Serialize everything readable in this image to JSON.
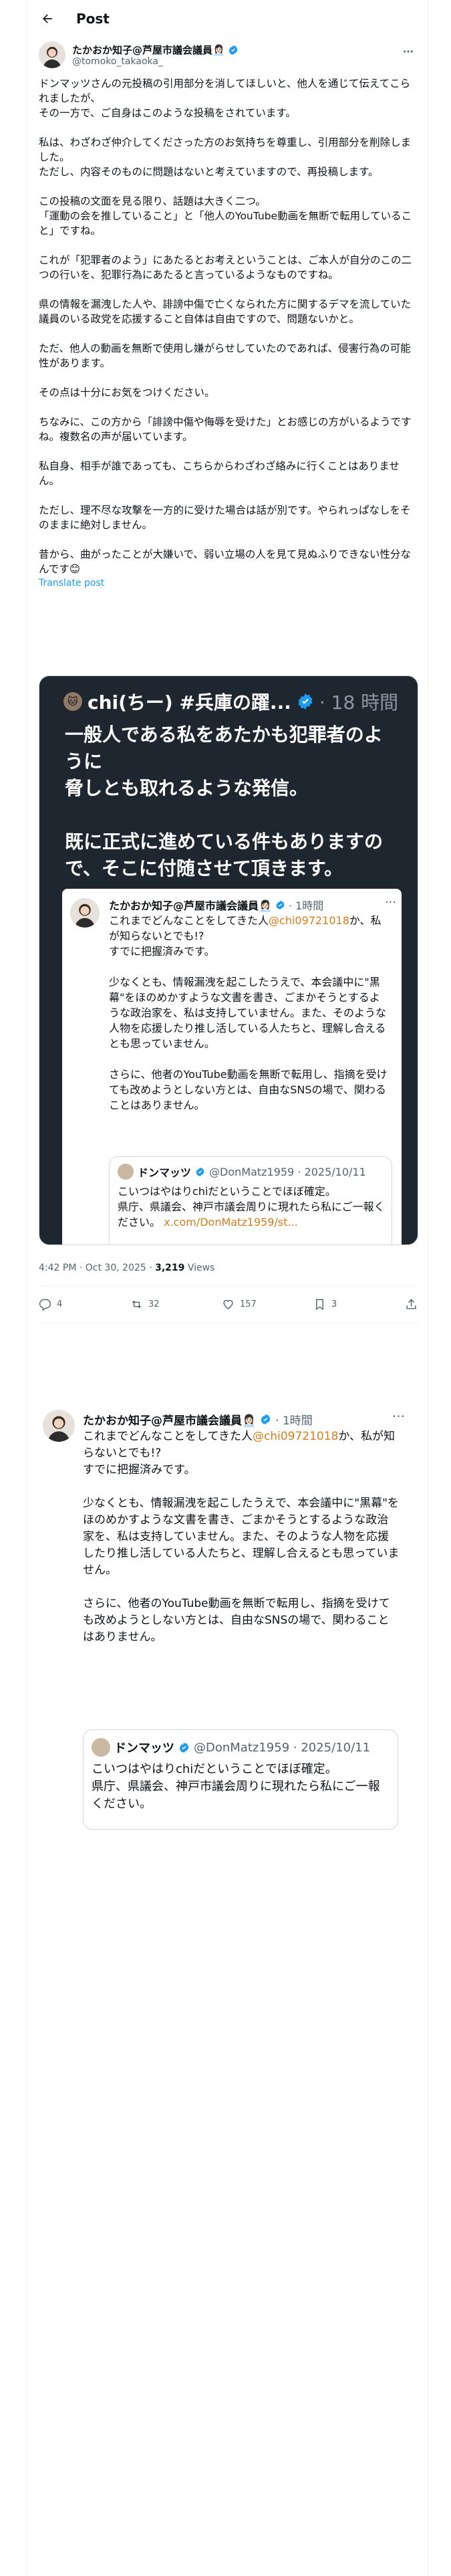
{
  "colors": {
    "accent": "#1d9bf0",
    "mention": "#d67c1b",
    "muted": "#536471",
    "card_dark": "#1e272f"
  },
  "topbar": {
    "title": "Post",
    "back_icon": "arrow-left-icon"
  },
  "author": {
    "name": "たかおか知子@芦屋市議会議員👩🏻‍💼",
    "handle": "@tomoko_takaoka_",
    "verified_icon": "verified-badge-icon",
    "more_icon": "more-icon"
  },
  "post": {
    "paragraphs": [
      "ドンマッツさんの元投稿の引用部分を消してほしいと、他人を通じて伝えてこられましたが、\nその一方で、ご自身はこのような投稿をされています。",
      "私は、わざわざ仲介してくださった方のお気持ちを尊重し、引用部分を削除しました。\nただし、内容そのものに問題はないと考えていますので、再投稿します。",
      "この投稿の文面を見る限り、話題は大きく二つ。\n「運動の会を推していること」と「他人のYouTube動画を無断で転用していること」ですね。",
      "これが「犯罪者のよう」にあたるとお考えということは、ご本人が自分のこの二つの行いを、犯罪行為にあたると言っているようなものですね。",
      "県の情報を漏洩した人や、誹謗中傷で亡くなられた方に関するデマを流していた議員のいる政党を応援すること自体は自由ですので、問題ないかと。",
      "ただ、他人の動画を無断で使用し嫌がらせしていたのであれば、侵害行為の可能性があります。",
      "その点は十分にお気をつけください。",
      "ちなみに、この方から「誹謗中傷や侮辱を受けた」とお感じの方がいるようですね。複数名の声が届いています。",
      "私自身、相手が誰であっても、こちらからわざわざ絡みに行くことはありません。",
      "ただし、理不尽な攻撃を一方的に受けた場合は話が別です。やられっぱなしをそのままに絶対しません。",
      "昔から、曲がったことが大嫌いで、弱い立場の人を見て見ぬふりできない性分なんです😊"
    ],
    "translate_label": "Translate post"
  },
  "media": {
    "avatar_emoji": "🐱",
    "name": "chi(ちー) #兵庫の躍...",
    "time": "· 18 時間",
    "text": "一般人である私をあたかも犯罪者のように\n脅しとも取れるような発信。\n\n既に正式に進めている件もありますので、そこに付随させて頂きます。",
    "inner": {
      "name": "たかおか知子@芦屋市議会議員👩🏻‍💼",
      "time": "· 1時間",
      "text_before_mention": "これまでどんなことをしてきた人",
      "mention": "@chi09721018",
      "text_after_mention": "か、私が知らないとでも!?\nすでに把握済みです。\n\n少なくとも、情報漏洩を起こしたうえで、本会議中に\"黒幕\"をほのめかすような文書を書き、ごまかそうとするような政治家を、私は支持していません。また、そのような人物を応援したり推し活している人たちと、理解し合えるとも思っていません。\n\nさらに、他者のYouTube動画を無断で転用し、指摘を受けても改めようとしない方とは、自由なSNSの場で、関わることはありません。",
      "quote": {
        "name": "ドンマッツ",
        "handle": "@DonMatz1959 · 2025/10/11",
        "text": "こいつはやはりchiだということでほぼ確定。\n県庁、県議会、神戸市議会周りに現れたら私にご一報ください。",
        "link": "x.com/DonMatz1959/st..."
      }
    }
  },
  "meta": {
    "time": "4:42 PM · Oct 30, 2025 · ",
    "views_count": "3,219",
    "views_label": " Views"
  },
  "actions": {
    "replies": "4",
    "reposts": "32",
    "likes": "157",
    "bookmarks": "3"
  },
  "second_shot": {
    "name": "たかおか知子@芦屋市議会議員👩🏻‍💼",
    "time": "· 1時間",
    "text_before_mention": "これまでどんなことをしてきた人",
    "mention": "@chi09721018",
    "text_after_mention": "か、私が知らないとでも!?\nすでに把握済みです。\n\n少なくとも、情報漏洩を起こしたうえで、本会議中に\"黒幕\"をほのめかすような文書を書き、ごまかそうとするような政治家を、私は支持していません。また、そのような人物を応援したり推し活している人たちと、理解し合えるとも思っていません。\n\nさらに、他者のYouTube動画を無断で転用し、指摘を受けても改めようとしない方とは、自由なSNSの場で、関わることはありません。",
    "quote": {
      "name": "ドンマッツ",
      "handle": "@DonMatz1959 · 2025/10/11",
      "text": "こいつはやはりchiだということでほぼ確定。\n県庁、県議会、神戸市議会周りに現れたら私にご一報ください。"
    }
  }
}
